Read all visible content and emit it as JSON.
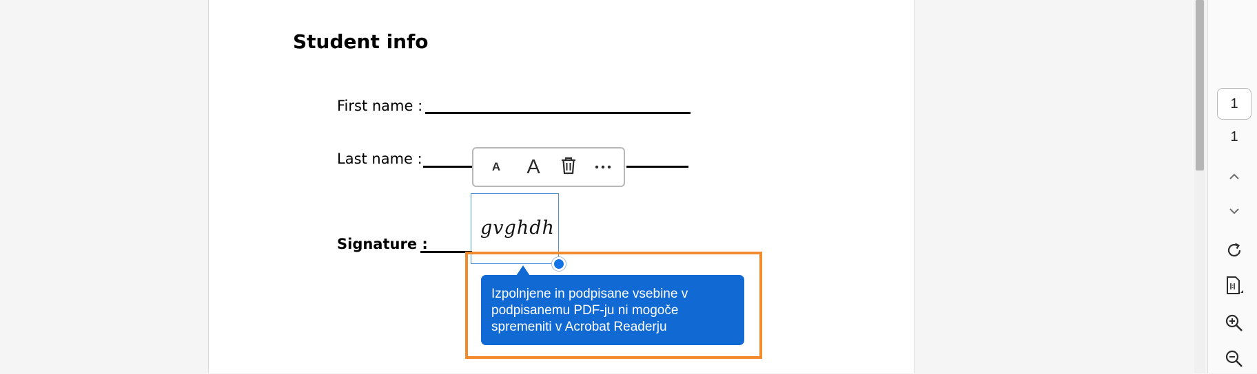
{
  "document": {
    "heading": "Student info",
    "fields": {
      "first_name_label": "First name :",
      "last_name_label": "Last name :",
      "signature_label": "Signature :"
    },
    "signature_value": "gvghdh"
  },
  "toolbar": {
    "decrease_text_size_label": "A",
    "increase_text_size_label": "A",
    "delete_icon": "trash-icon",
    "more_icon": "more-horizontal-icon"
  },
  "tooltip": {
    "text": "Izpolnjene in podpisane vsebine v podpisanemu PDF-ju ni mogoče spremeniti v Acrobat Readerju"
  },
  "navigation": {
    "current_page": "1",
    "total_pages": "1",
    "icons": [
      "chevron-up-icon",
      "chevron-down-icon",
      "rotate-icon",
      "fit-page-icon",
      "zoom-in-icon",
      "zoom-out-icon"
    ]
  },
  "colors": {
    "accent": "#1169d4",
    "highlight": "#f28a2e",
    "selection_border": "#4f8fd6"
  }
}
